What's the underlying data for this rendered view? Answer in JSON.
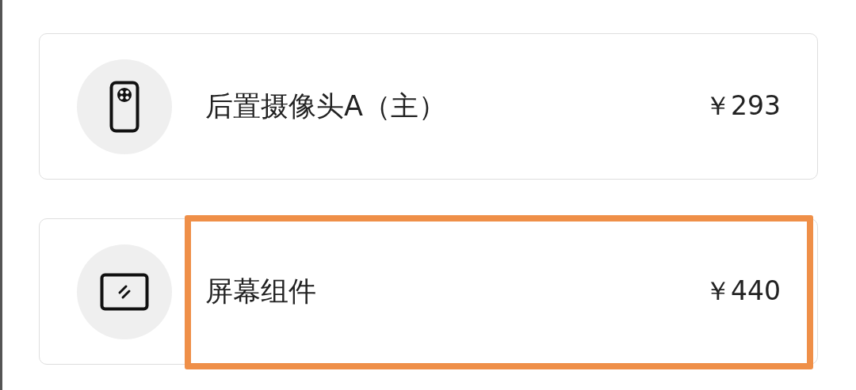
{
  "parts": [
    {
      "kind": "camera",
      "name": "后置摄像头A（主）",
      "price": "￥293",
      "highlighted": false
    },
    {
      "kind": "screen",
      "name": "屏幕组件",
      "price": "￥440",
      "highlighted": true
    }
  ]
}
